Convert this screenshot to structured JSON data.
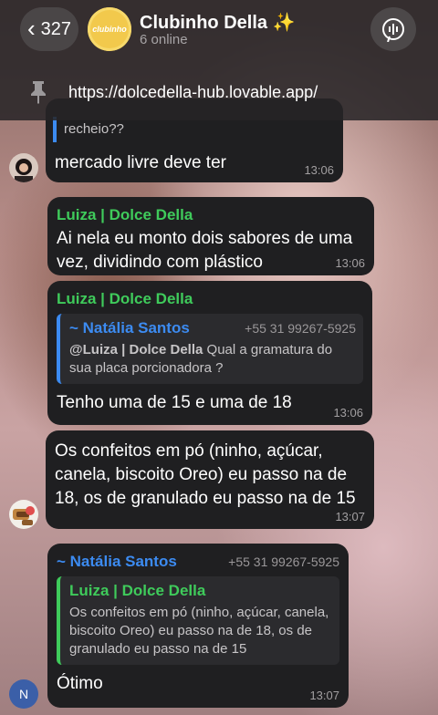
{
  "header": {
    "back_count": "327",
    "group_avatar_text": "clubinho",
    "title": "Clubinho Della ✨",
    "subtitle": "6 online"
  },
  "pinned": {
    "link": "https://dolcedella-hub.lovable.app/"
  },
  "messages": [
    {
      "partial_quote": "recheio??",
      "text": "mercado livre deve ter",
      "time": "13:06"
    },
    {
      "sender": "Luiza | Dolce Della",
      "text": "Ai nela eu monto dois sabores de uma vez, dividindo com plástico",
      "time": "13:06"
    },
    {
      "sender": "Luiza | Dolce Della",
      "quote_name": "~ Natália Santos",
      "quote_phone": "+55 31 99267-5925",
      "quote_mention": "@Luiza | Dolce Della",
      "quote_text": " Qual a gramatura do sua placa porcionadora ?",
      "text": "Tenho uma de 15 e uma de 18",
      "time": "13:06"
    },
    {
      "text": "Os confeitos em pó (ninho, açúcar, canela, biscoito Oreo) eu passo na de 18, os de granulado eu passo na de 15",
      "time": "13:07"
    },
    {
      "sender_name": "~ Natália Santos",
      "sender_phone": "+55 31 99267-5925",
      "quote_name": "Luiza | Dolce Della",
      "quote_text": "Os confeitos em pó (ninho, açúcar, canela, biscoito Oreo) eu passo na de 18, os de granulado eu passo na de 15",
      "text": "Ótimo",
      "time": "13:07",
      "avatar_initial": "N"
    }
  ],
  "colors": {
    "accent_green": "#3fcb5b",
    "accent_blue": "#3c8bf1",
    "avatar_blue": "#3b5fa8"
  },
  "icons": {
    "back": "chevron-left-icon",
    "voice": "voice-chat-icon",
    "pin": "pin-icon"
  }
}
